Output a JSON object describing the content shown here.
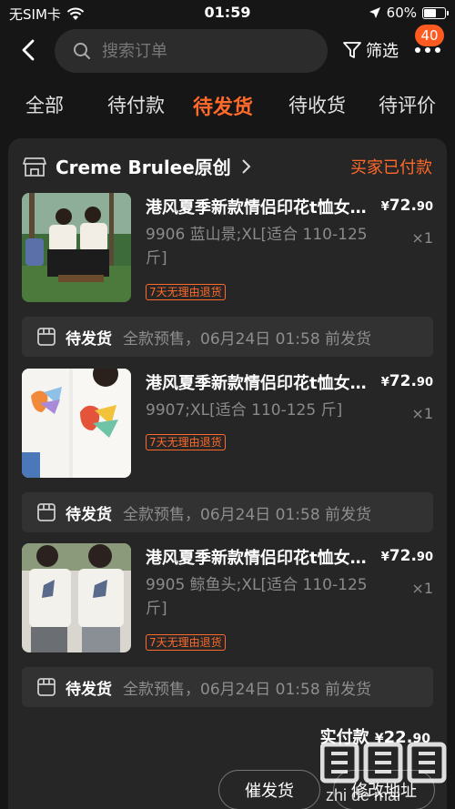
{
  "status_bar": {
    "carrier": "无SIM卡",
    "time": "01:59",
    "battery": "60%",
    "battery_level": 0.6,
    "icons": [
      "wifi-icon",
      "location-arrow-icon",
      "battery-icon"
    ]
  },
  "header": {
    "search_placeholder": "搜索订单",
    "filter_label": "筛选",
    "message_badge": "40"
  },
  "tabs": [
    {
      "label": "全部",
      "active": false
    },
    {
      "label": "待付款",
      "active": false
    },
    {
      "label": "待发货",
      "active": true
    },
    {
      "label": "待收货",
      "active": false
    },
    {
      "label": "待评价",
      "active": false
    }
  ],
  "order": {
    "shop_name": "Creme Brulee原创",
    "status": "买家已付款",
    "items": [
      {
        "title": "港风夏季新款情侣印花t恤女短袖",
        "spec": "9906 蓝山景;XL[适合 110-125 斤]",
        "tag": "7天无理由退货",
        "price_symbol": "¥",
        "price_int": "72.",
        "price_dec": "90",
        "qty": "×1",
        "ship_label": "待发货",
        "ship_desc": "全款预售，06月24日 01:58 前发货"
      },
      {
        "title": "港风夏季新款情侣印花t恤女短袖",
        "spec": "9907;XL[适合 110-125 斤]",
        "tag": "7天无理由退货",
        "price_symbol": "¥",
        "price_int": "72.",
        "price_dec": "90",
        "qty": "×1",
        "ship_label": "待发货",
        "ship_desc": "全款预售，06月24日 01:58 前发货"
      },
      {
        "title": "港风夏季新款情侣印花t恤女短袖",
        "spec": "9905 鲸鱼头;XL[适合 110-125 斤]",
        "tag": "7天无理由退货",
        "price_symbol": "¥",
        "price_int": "72.",
        "price_dec": "90",
        "qty": "×1",
        "ship_label": "待发货",
        "ship_desc": "全款预售，06月24日 01:58 前发货"
      }
    ],
    "total_label": "实付款",
    "total_symbol": "¥",
    "total_int": "22.",
    "total_dec": "90",
    "buttons": {
      "urge": "催发货",
      "modify_address": "修改地址"
    }
  },
  "watermark": "值 什么值得买",
  "colors": {
    "accent": "#ff6a2a",
    "background": "#161616",
    "card": "#262626"
  }
}
